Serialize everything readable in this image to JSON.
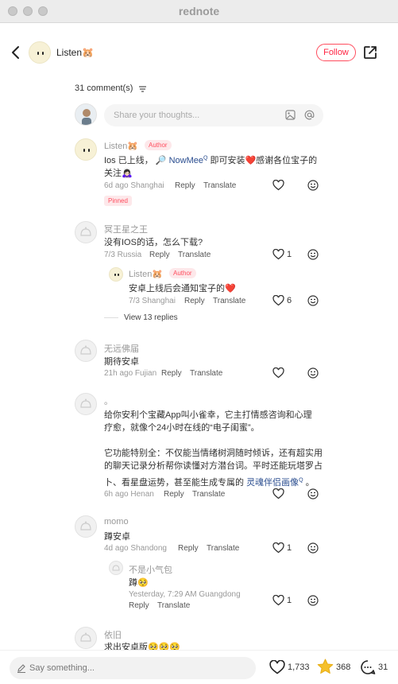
{
  "window": {
    "title": "rednote"
  },
  "header": {
    "username": "Listen🐹",
    "follow_label": "Follow"
  },
  "comments_header": {
    "count_label": "31 comment(s)"
  },
  "composer": {
    "placeholder": "Share your thoughts..."
  },
  "comments": [
    {
      "name": "Listen🐹",
      "badge": "Author",
      "text_pre": "Ios 已上线，",
      "search_link": "NowMee",
      "text_post": "即可安装❤️感谢各位宝子的",
      "text_line2": "关注🙇🏻‍♀️",
      "meta": "6d ago Shanghai",
      "reply": "Reply",
      "translate": "Translate",
      "pinned": "Pinned"
    },
    {
      "name": "冥王星之王",
      "text": "没有IOS的话，怎么下载?",
      "meta": "7/3 Russia",
      "reply": "Reply",
      "translate": "Translate",
      "likes": "1",
      "reply_item": {
        "name": "Listen🐹",
        "badge": "Author",
        "text": "安卓上线后会通知宝子的❤️",
        "meta": "7/3 Shanghai",
        "reply": "Reply",
        "translate": "Translate",
        "likes": "6"
      },
      "view_replies": "View 13 replies"
    },
    {
      "name": "无远佛届",
      "text": "期待安卓",
      "meta": "21h ago Fujian",
      "reply": "Reply",
      "translate": "Translate"
    },
    {
      "name": "。",
      "line1": "给你安利个宝藏App叫小雀幸，它主打情感咨询和心理",
      "line2": "疗愈，就像个24小时在线的“电子闺蜜”。",
      "line3": "它功能特别全：不仅能当情绪树洞随时倾诉，还有超实用",
      "line4": "的聊天记录分析帮你读懂对方潜台词。平时还能玩塔罗占",
      "line5_pre": "卜、看星盘运势，甚至能生成专属的",
      "line5_link": "灵魂伴侣画像",
      "line5_post": "。",
      "meta": "6h ago Henan",
      "reply": "Reply",
      "translate": "Translate"
    },
    {
      "name": "momo",
      "text": "蹲安卓",
      "meta": "4d ago Shandong",
      "reply": "Reply",
      "translate": "Translate",
      "likes": "1",
      "reply_item": {
        "name": "不是小气包",
        "text": "蹲🥺",
        "meta": "Yesterday, 7:29 AM Guangdong",
        "reply": "Reply",
        "translate": "Translate",
        "likes": "1"
      }
    },
    {
      "name": "依旧",
      "text": "求出安卓版🥺🥺🥺"
    }
  ],
  "bottom_bar": {
    "placeholder": "Say something...",
    "likes": "1,733",
    "collects": "368",
    "comments": "31"
  },
  "colors": {
    "accent": "#ff2442",
    "link": "#2a4d8f",
    "star": "#f5c02b"
  }
}
